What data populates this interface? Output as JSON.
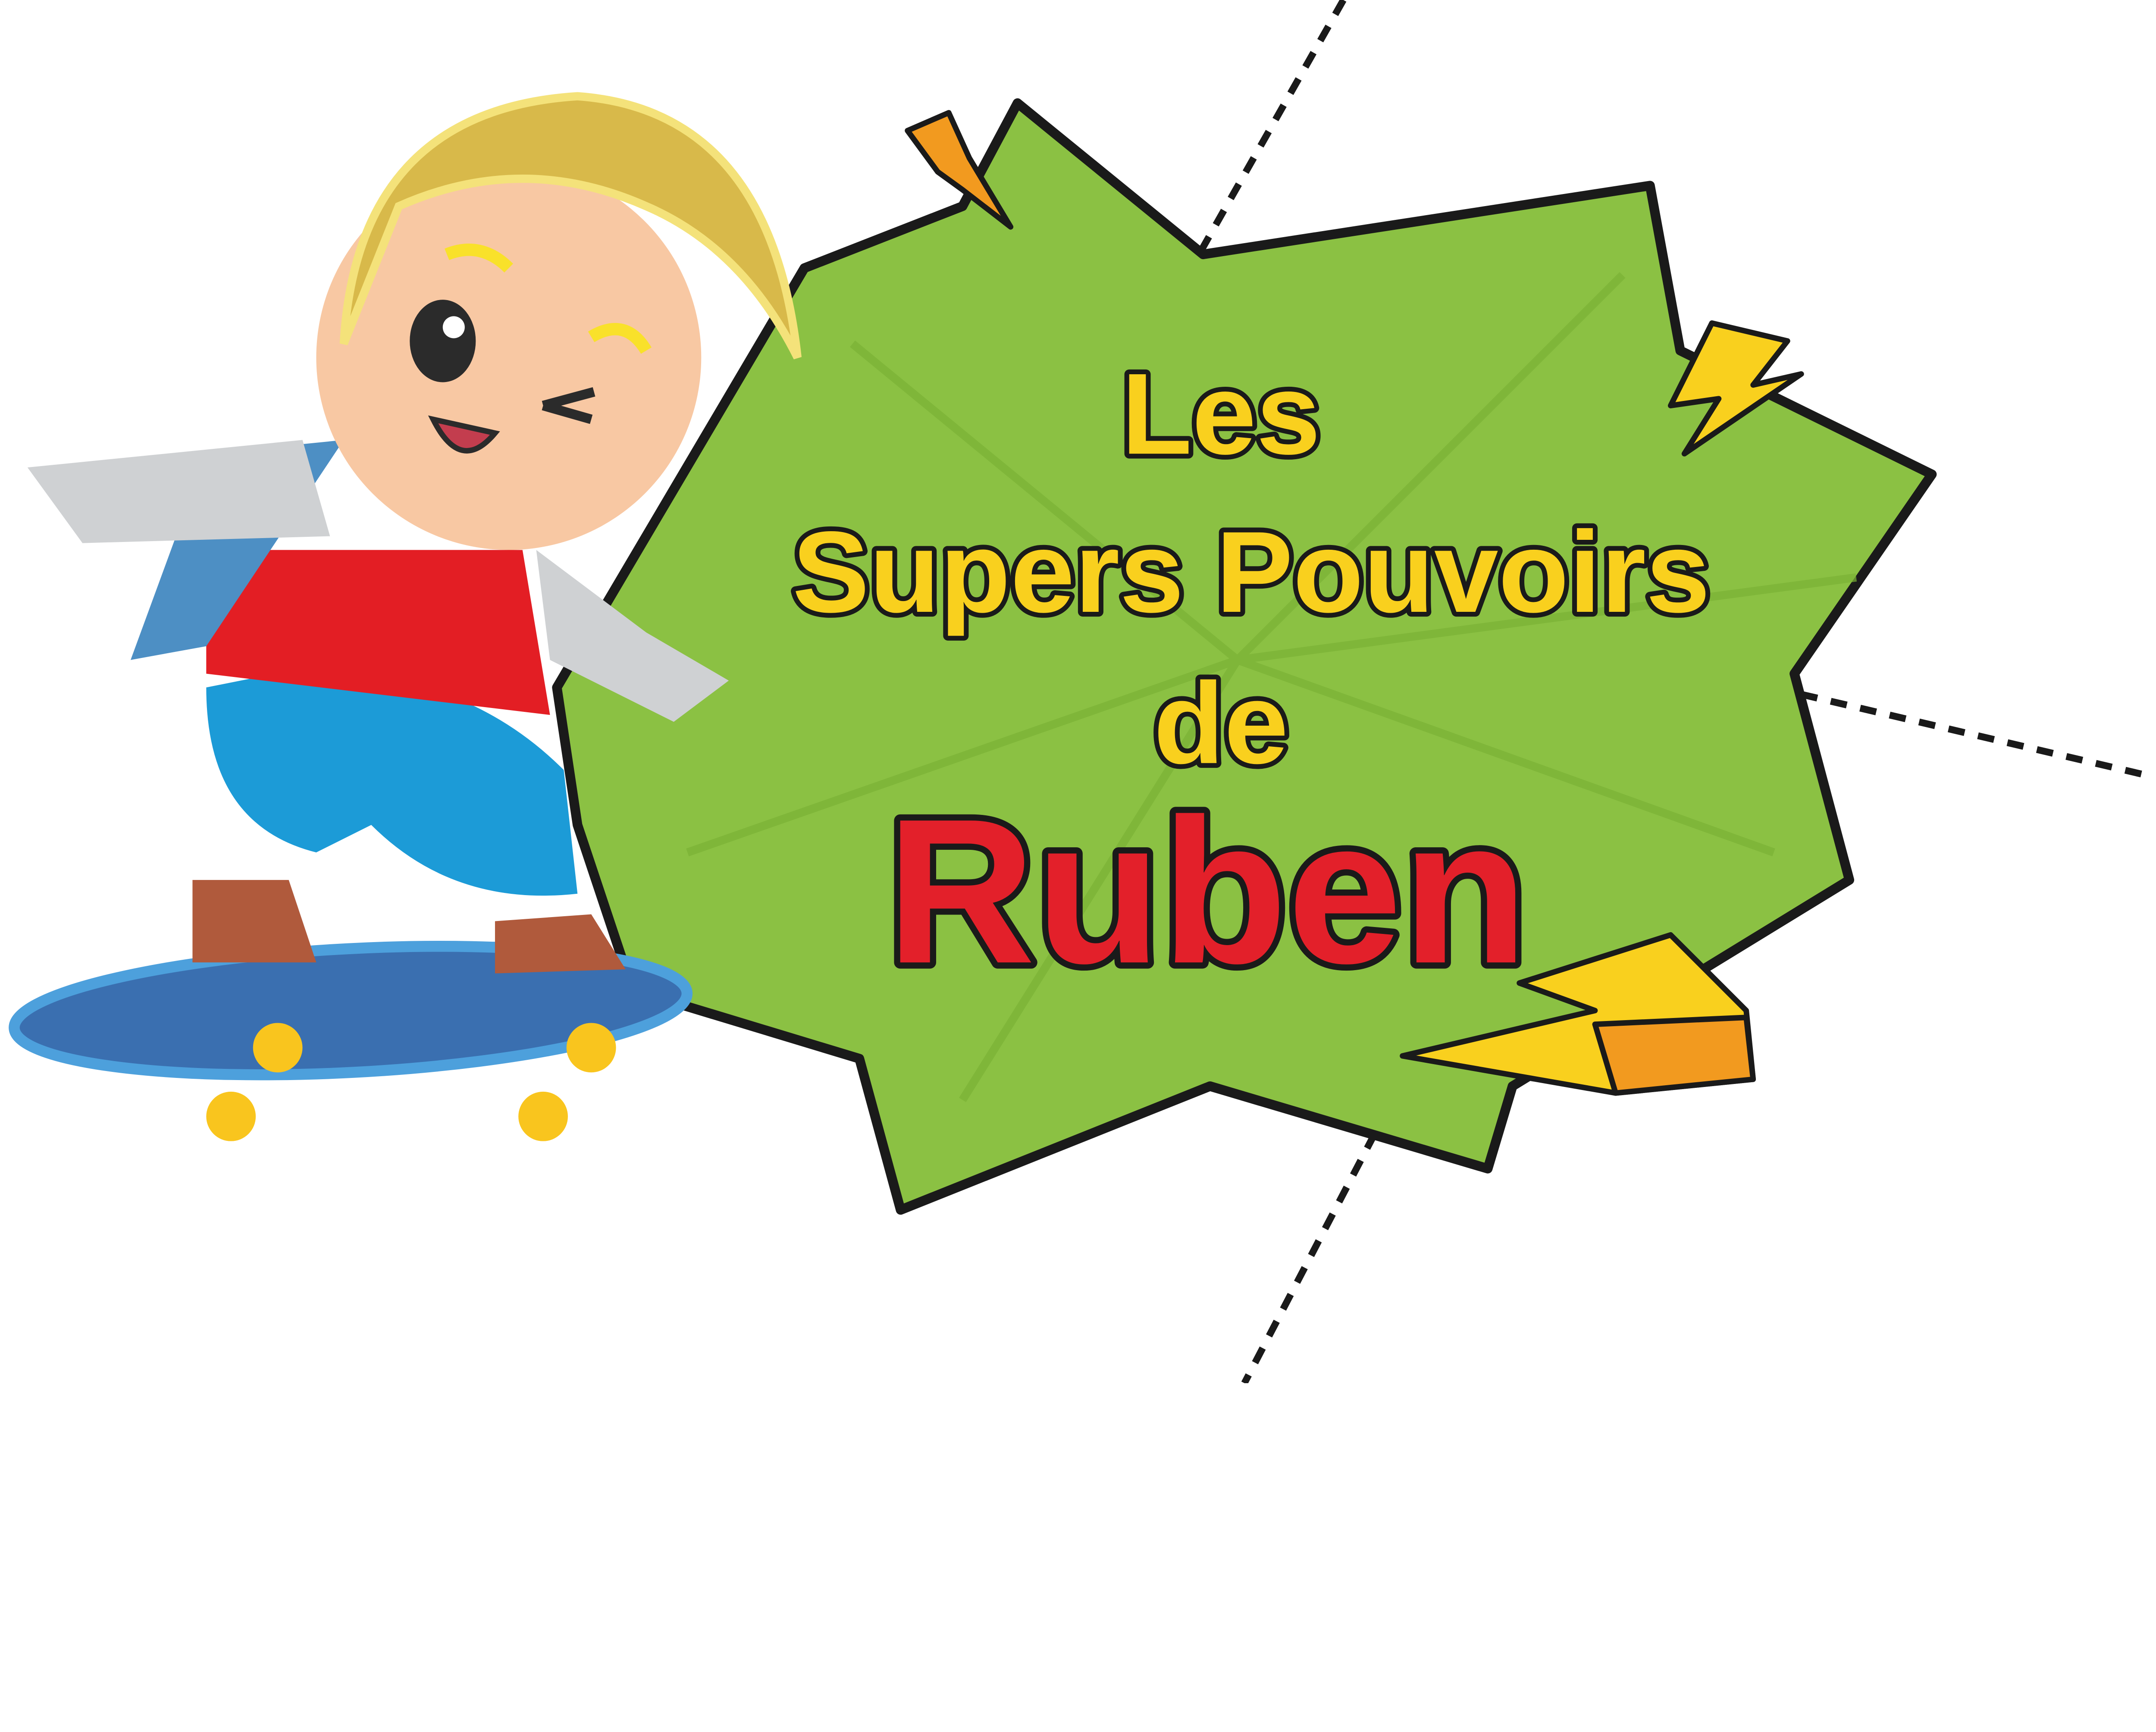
{
  "title": {
    "line1": "Les",
    "line2": "Supers Pouvoirs",
    "line3": "de",
    "name": "Ruben"
  },
  "colors": {
    "burst_green": "#8bc143",
    "title_yellow": "#f9d01e",
    "name_red": "#e3202a",
    "bolt_orange": "#f29a1f",
    "outline": "#1a1a1a"
  },
  "icons": [
    "lightning-bolt-icon",
    "skateboard-boy-illustration"
  ]
}
